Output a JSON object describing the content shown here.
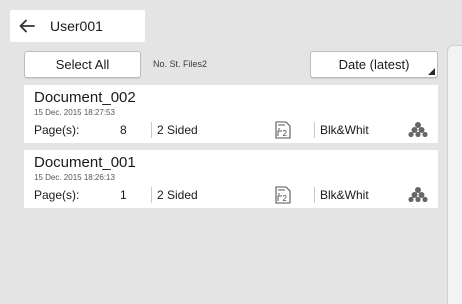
{
  "header": {
    "title": "User001",
    "back_icon": "arrow-left-icon"
  },
  "toolbar": {
    "select_all_label": "Select All",
    "files_count_label": "No. St. Files2",
    "sort_label": "Date (latest)"
  },
  "documents": [
    {
      "name": "Document_002",
      "date": "15 Dec. 2015 18:27:53",
      "pages_label": "Page(s):",
      "pages": "8",
      "sided": "2 Sided",
      "layout_icon": "combine-2-icon",
      "color_mode": "Blk&Whit",
      "toner_icon": "toner-dots-icon"
    },
    {
      "name": "Document_001",
      "date": "15 Dec. 2015 18:26:13",
      "pages_label": "Page(s):",
      "pages": "1",
      "sided": "2 Sided",
      "layout_icon": "combine-2-icon",
      "color_mode": "Blk&Whit",
      "toner_icon": "toner-dots-icon"
    }
  ]
}
